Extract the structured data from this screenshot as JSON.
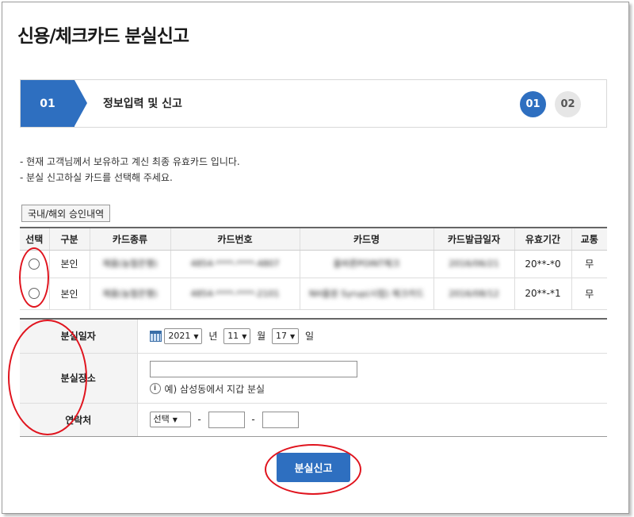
{
  "page": {
    "title": "신용/체크카드 분실신고"
  },
  "steps": {
    "current_number": "01",
    "current_title": "정보입력 및 신고",
    "indicators": [
      "01",
      "02"
    ]
  },
  "notes": [
    "- 현재 고객님께서 보유하고 계신 최종 유효카드 입니다.",
    "- 분실 신고하실 카드를 선택해 주세요."
  ],
  "history_button": "국내/해외 승인내역",
  "card_table": {
    "headers": [
      "선택",
      "구분",
      "카드종류",
      "카드번호",
      "카드명",
      "카드발급일자",
      "유효기간",
      "교통"
    ],
    "rows": [
      {
        "type": "본인",
        "kind": "채움(농협은행)",
        "number": "4854-****-****-4807",
        "name": "올바른POINT체크",
        "issued": "2016/06/21",
        "expiry": "20**-*0",
        "transit": "무"
      },
      {
        "type": "본인",
        "kind": "채움(농협은행)",
        "number": "4854-****-****-2101",
        "name": "NH올원 Syrup(시럽) 체크카드",
        "issued": "2016/08/12",
        "expiry": "20**-*1",
        "transit": "무"
      }
    ]
  },
  "form": {
    "date": {
      "label": "분실일자",
      "year": "2021",
      "year_unit": "년",
      "month": "11",
      "month_unit": "월",
      "day": "17",
      "day_unit": "일"
    },
    "place": {
      "label": "분실장소",
      "value": "",
      "hint_icon": "i",
      "hint": "예) 삼성동에서 지갑 분실"
    },
    "contact": {
      "label": "연락처",
      "select": "선택",
      "dash": "-"
    }
  },
  "submit_label": "분실신고",
  "colors": {
    "primary": "#2e6fc0",
    "annotation": "#e0141e"
  },
  "icons": {
    "calendar": "calendar-icon",
    "info": "info-icon",
    "dropdown": "chevron-down-icon"
  }
}
